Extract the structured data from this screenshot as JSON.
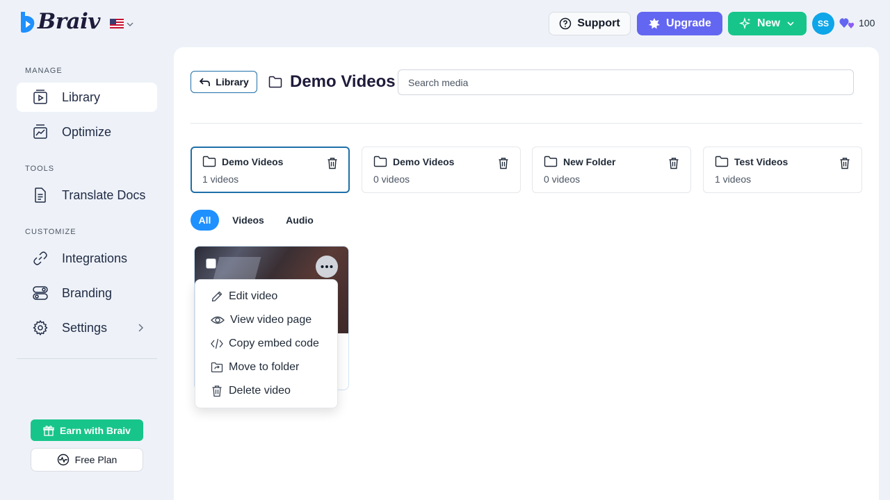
{
  "brand": {
    "name": "Braiv",
    "color": "#1e1b3a",
    "accent": "#1e90ff"
  },
  "header": {
    "locale_flag": "us-flag-icon",
    "support_label": "Support",
    "upgrade_label": "Upgrade",
    "new_label": "New",
    "avatar_initials": "SS",
    "credits": "100"
  },
  "sidebar": {
    "sections": [
      {
        "label": "MANAGE",
        "items": [
          {
            "label": "Library",
            "icon": "library-icon",
            "active": true
          },
          {
            "label": "Optimize",
            "icon": "optimize-icon"
          }
        ]
      },
      {
        "label": "TOOLS",
        "items": [
          {
            "label": "Translate Docs",
            "icon": "document-icon"
          }
        ]
      },
      {
        "label": "CUSTOMIZE",
        "items": [
          {
            "label": "Integrations",
            "icon": "link-icon"
          },
          {
            "label": "Branding",
            "icon": "toggles-icon"
          },
          {
            "label": "Settings",
            "icon": "gear-icon"
          }
        ]
      }
    ],
    "earn_label": "Earn with Braiv",
    "plan_label": "Free Plan"
  },
  "main": {
    "back_label": "Library",
    "title": "Demo Videos",
    "search_placeholder": "Search media",
    "folders": [
      {
        "name": "Demo Videos",
        "count": "1 videos",
        "selected": true
      },
      {
        "name": "Demo Videos",
        "count": "0 videos"
      },
      {
        "name": "New Folder",
        "count": "0 videos"
      },
      {
        "name": "Test Videos",
        "count": "1 videos"
      }
    ],
    "filters": [
      {
        "label": "All",
        "active": true
      },
      {
        "label": "Videos"
      },
      {
        "label": "Audio"
      }
    ],
    "context_menu": [
      {
        "label": "Edit video",
        "icon": "pencil-icon"
      },
      {
        "label": "View video page",
        "icon": "eye-icon"
      },
      {
        "label": "Copy embed code",
        "icon": "code-icon"
      },
      {
        "label": "Move to folder",
        "icon": "folder-move-icon"
      },
      {
        "label": "Delete video",
        "icon": "trash-icon"
      }
    ]
  },
  "colors": {
    "green": "#17c58a",
    "indigo": "#6366f1",
    "sky": "#0ea5e9",
    "selected_border": "#1e6fa8"
  }
}
